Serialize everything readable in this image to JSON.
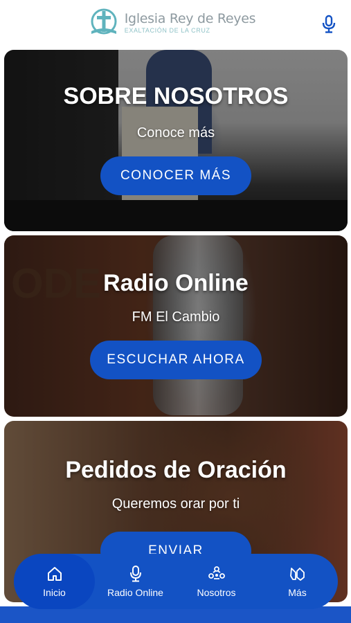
{
  "header": {
    "title": "Iglesia Rey de Reyes",
    "subtitle": "EXALTACIÓN DE LA CRUZ",
    "logo_icon": "church-cross-logo",
    "mic_icon": "microphone-icon"
  },
  "cards": [
    {
      "title": "SOBRE NOSOTROS",
      "subtitle": "Conoce más",
      "button": "CONOCER MÁS"
    },
    {
      "title": "Radio Online",
      "subtitle": "FM El Cambio",
      "button": "ESCUCHAR AHORA",
      "bg_text": "ODE"
    },
    {
      "title": "Pedidos de Oración",
      "subtitle": "Queremos orar por ti",
      "button": "ENVIAR"
    }
  ],
  "nav": {
    "items": [
      {
        "label": "Inicio",
        "icon": "home-icon",
        "active": true
      },
      {
        "label": "Radio Online",
        "icon": "microphone-icon",
        "active": false
      },
      {
        "label": "Nosotros",
        "icon": "community-icon",
        "active": false
      },
      {
        "label": "Más",
        "icon": "praying-hands-icon",
        "active": false
      }
    ]
  },
  "colors": {
    "primary": "#1352c4",
    "nav_active": "#0a46c0",
    "logo_teal": "#5fb3bd",
    "logo_text": "#8e9aa0"
  }
}
